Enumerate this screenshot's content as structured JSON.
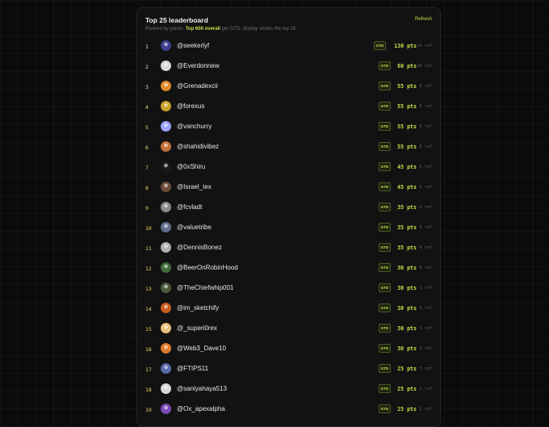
{
  "leaderboard": {
    "title": "Top 25 leaderboard",
    "refresh_label": "Refresh",
    "subtitle_pre": "Ranked by points.",
    "subtitle_highlight": "Top 600 overall",
    "subtitle_post": "get GTD; display shows the top 25.",
    "badge_label": "GTD",
    "accent_color": "#c8e04a",
    "rows": [
      {
        "rank": "1",
        "handle": "@seekerlyf",
        "points": "130 pts",
        "refs": "24 ref",
        "avatar_color": "#3a3f8f",
        "avatar_icon": "character-icon"
      },
      {
        "rank": "2",
        "handle": "@Everdonnew",
        "points": "60 pts",
        "refs": "18 ref",
        "avatar_color": "#d8d8d8",
        "avatar_icon": "face-icon"
      },
      {
        "rank": "3",
        "handle": "@Grenadexcii",
        "points": "55 pts",
        "refs": "9 ref",
        "avatar_color": "#e08a2a",
        "avatar_icon": "face-icon"
      },
      {
        "rank": "4",
        "handle": "@forexus",
        "points": "55 pts",
        "refs": "8 ref",
        "avatar_color": "#c9a227",
        "avatar_icon": "logo-icon"
      },
      {
        "rank": "5",
        "handle": "@vanchurry",
        "points": "55 pts",
        "refs": "8 ref",
        "avatar_color": "#9aa4ff",
        "avatar_icon": "cartoon-icon"
      },
      {
        "rank": "6",
        "handle": "@shahidivibez",
        "points": "55 pts",
        "refs": "8 ref",
        "avatar_color": "#c0703a",
        "avatar_icon": "pattern-icon"
      },
      {
        "rank": "7",
        "handle": "@0xShiru",
        "points": "45 pts",
        "refs": "6 ref",
        "avatar_color": "#1a1a1a",
        "avatar_icon": "silhouette-icon"
      },
      {
        "rank": "8",
        "handle": "@Israel_tex",
        "points": "45 pts",
        "refs": "6 ref",
        "avatar_color": "#6b4a3a",
        "avatar_icon": "face-icon"
      },
      {
        "rank": "9",
        "handle": "@fcvladt",
        "points": "35 pts",
        "refs": "4 ref",
        "avatar_color": "#8a8a8a",
        "avatar_icon": "face-icon"
      },
      {
        "rank": "10",
        "handle": "@valuetribe",
        "points": "35 pts",
        "refs": "4 ref",
        "avatar_color": "#5f6f8a",
        "avatar_icon": "robot-icon"
      },
      {
        "rank": "11",
        "handle": "@DennisBonez",
        "points": "35 pts",
        "refs": "4 ref",
        "avatar_color": "#b0b0b0",
        "avatar_icon": "face-icon"
      },
      {
        "rank": "12",
        "handle": "@BeerOnRobinHood",
        "points": "30 pts",
        "refs": "4 ref",
        "avatar_color": "#3f6b3a",
        "avatar_icon": "character-icon"
      },
      {
        "rank": "13",
        "handle": "@TheChiefwhip001",
        "points": "30 pts",
        "refs": "3 ref",
        "avatar_color": "#4a5a3a",
        "avatar_icon": "pattern-icon"
      },
      {
        "rank": "14",
        "handle": "@im_sketchify",
        "points": "30 pts",
        "refs": "3 ref",
        "avatar_color": "#c85a1a",
        "avatar_icon": "logo-icon"
      },
      {
        "rank": "15",
        "handle": "@_superi0rex",
        "points": "30 pts",
        "refs": "3 ref",
        "avatar_color": "#e8c27a",
        "avatar_icon": "cartoon-icon"
      },
      {
        "rank": "16",
        "handle": "@Web3_Dave10",
        "points": "30 pts",
        "refs": "3 ref",
        "avatar_color": "#e07a2a",
        "avatar_icon": "face-icon"
      },
      {
        "rank": "17",
        "handle": "@FTIPS11",
        "points": "25 pts",
        "refs": "3 ref",
        "avatar_color": "#5a6aa8",
        "avatar_icon": "pattern-icon"
      },
      {
        "rank": "18",
        "handle": "@saniyahaya513",
        "points": "25 pts",
        "refs": "2 ref",
        "avatar_color": "#d8d8d8",
        "avatar_icon": "face-icon"
      },
      {
        "rank": "19",
        "handle": "@Ox_apexalpha",
        "points": "25 pts",
        "refs": "2 ref",
        "avatar_color": "#7a4ab8",
        "avatar_icon": "character-icon"
      }
    ]
  }
}
